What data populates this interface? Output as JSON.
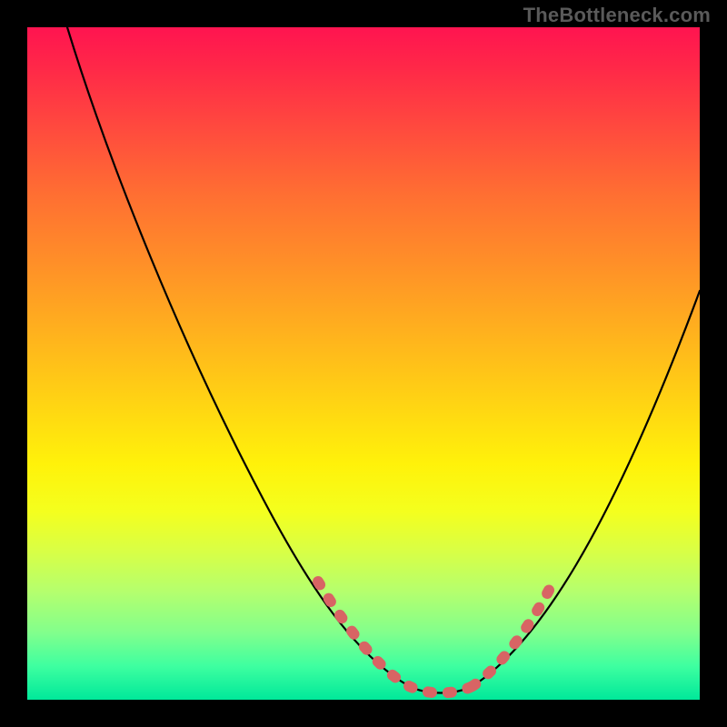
{
  "watermark": "TheBottleneck.com",
  "chart_data": {
    "type": "line",
    "title": "",
    "xlabel": "",
    "ylabel": "",
    "xlim": [
      0,
      100
    ],
    "ylim": [
      0,
      100
    ],
    "grid": false,
    "annotations": [
      "TheBottleneck.com"
    ],
    "series": [
      {
        "name": "bottleneck-curve",
        "x": [
          6,
          10,
          14,
          18,
          22,
          26,
          30,
          34,
          38,
          42,
          46,
          50,
          54,
          58,
          62,
          66,
          70,
          74,
          78,
          82,
          86,
          90,
          94,
          100
        ],
        "y": [
          100,
          90,
          80,
          70,
          61,
          52,
          44,
          36,
          29,
          22,
          16,
          10,
          5,
          2,
          1,
          2,
          6,
          12,
          20,
          28,
          36,
          44,
          52,
          62
        ]
      },
      {
        "name": "marker-segments",
        "description": "salmon dashed markers near valley",
        "x": [
          40,
          44,
          48,
          52,
          56,
          60,
          64,
          68,
          72,
          76
        ],
        "y": [
          22,
          15,
          9,
          5,
          2,
          1,
          2,
          6,
          13,
          22
        ]
      }
    ],
    "gradient_stops": [
      {
        "pos": 0,
        "color": "#ff1450"
      },
      {
        "pos": 100,
        "color": "#00e89a"
      }
    ]
  }
}
